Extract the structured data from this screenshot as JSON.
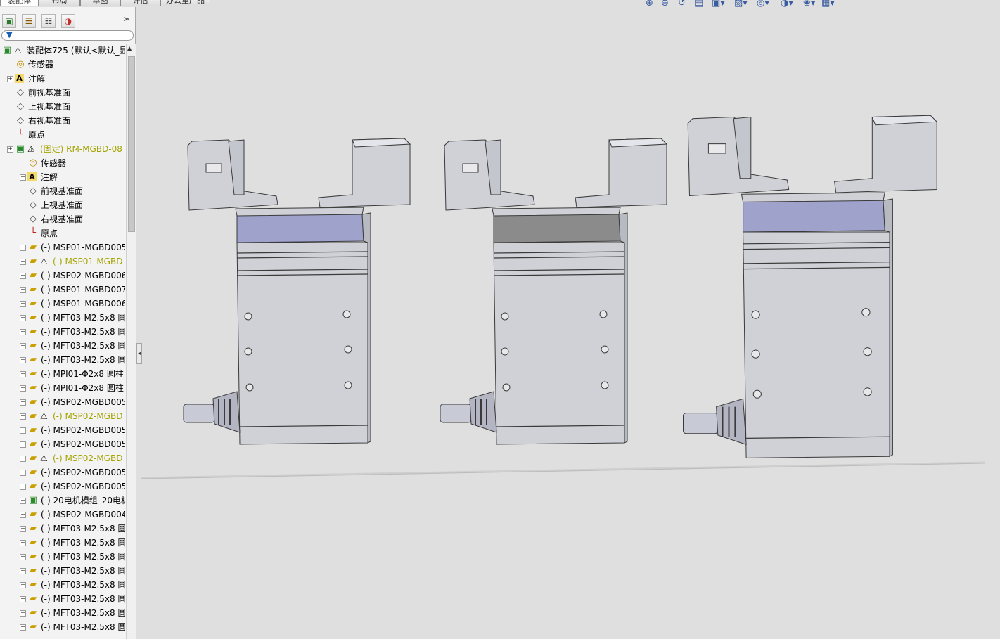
{
  "tabs": [
    "装配体",
    "布局",
    "草图",
    "评估",
    "办公室产品"
  ],
  "panel_icons": [
    {
      "name": "feature-manager-icon",
      "glyph": "▣"
    },
    {
      "name": "property-manager-icon",
      "glyph": "☰"
    },
    {
      "name": "configuration-manager-icon",
      "glyph": "☷"
    },
    {
      "name": "display-manager-icon",
      "glyph": "◑"
    }
  ],
  "tree": [
    {
      "label": "装配体725  (默认<默认_显",
      "depth": 0,
      "icon": "assembly",
      "warn": true,
      "exp": false,
      "style": "normal"
    },
    {
      "label": "传感器",
      "depth": 1,
      "icon": "sensor",
      "warn": false,
      "exp": false,
      "style": "normal"
    },
    {
      "label": "注解",
      "depth": 1,
      "icon": "annotation",
      "warn": false,
      "exp": true,
      "style": "normal"
    },
    {
      "label": "前视基准面",
      "depth": 1,
      "icon": "plane",
      "warn": false,
      "exp": false,
      "style": "normal"
    },
    {
      "label": "上视基准面",
      "depth": 1,
      "icon": "plane",
      "warn": false,
      "exp": false,
      "style": "normal"
    },
    {
      "label": "右视基准面",
      "depth": 1,
      "icon": "plane",
      "warn": false,
      "exp": false,
      "style": "normal"
    },
    {
      "label": "原点",
      "depth": 1,
      "icon": "origin",
      "warn": false,
      "exp": false,
      "style": "normal"
    },
    {
      "label": "(固定) RM-MGBD-08",
      "depth": 1,
      "icon": "subassembly",
      "warn": true,
      "exp": true,
      "style": "yellow"
    },
    {
      "label": "传感器",
      "depth": 2,
      "icon": "sensor",
      "warn": false,
      "exp": false,
      "style": "normal"
    },
    {
      "label": "注解",
      "depth": 2,
      "icon": "annotation",
      "warn": false,
      "exp": true,
      "style": "normal"
    },
    {
      "label": "前视基准面",
      "depth": 2,
      "icon": "plane",
      "warn": false,
      "exp": false,
      "style": "normal"
    },
    {
      "label": "上视基准面",
      "depth": 2,
      "icon": "plane",
      "warn": false,
      "exp": false,
      "style": "normal"
    },
    {
      "label": "右视基准面",
      "depth": 2,
      "icon": "plane",
      "warn": false,
      "exp": false,
      "style": "normal"
    },
    {
      "label": "原点",
      "depth": 2,
      "icon": "origin",
      "warn": false,
      "exp": false,
      "style": "normal"
    },
    {
      "label": "(-) MSP01-MGBD005",
      "depth": 2,
      "icon": "part",
      "warn": false,
      "exp": true,
      "style": "normal"
    },
    {
      "label": "(-) MSP01-MGBD",
      "depth": 2,
      "icon": "part",
      "warn": true,
      "exp": true,
      "style": "yellow"
    },
    {
      "label": "(-) MSP02-MGBD006",
      "depth": 2,
      "icon": "part",
      "warn": false,
      "exp": true,
      "style": "normal"
    },
    {
      "label": "(-) MSP01-MGBD007",
      "depth": 2,
      "icon": "part",
      "warn": false,
      "exp": true,
      "style": "normal"
    },
    {
      "label": "(-) MSP01-MGBD006",
      "depth": 2,
      "icon": "part",
      "warn": false,
      "exp": true,
      "style": "normal"
    },
    {
      "label": "(-) MFT03-M2.5x8 圆",
      "depth": 2,
      "icon": "part",
      "warn": false,
      "exp": true,
      "style": "normal"
    },
    {
      "label": "(-) MFT03-M2.5x8 圆",
      "depth": 2,
      "icon": "part",
      "warn": false,
      "exp": true,
      "style": "normal"
    },
    {
      "label": "(-) MFT03-M2.5x8 圆",
      "depth": 2,
      "icon": "part",
      "warn": false,
      "exp": true,
      "style": "normal"
    },
    {
      "label": "(-) MFT03-M2.5x8 圆",
      "depth": 2,
      "icon": "part",
      "warn": false,
      "exp": true,
      "style": "normal"
    },
    {
      "label": "(-) MPI01-Φ2x8 圆柱",
      "depth": 2,
      "icon": "part",
      "warn": false,
      "exp": true,
      "style": "normal"
    },
    {
      "label": "(-) MPI01-Φ2x8 圆柱",
      "depth": 2,
      "icon": "part",
      "warn": false,
      "exp": true,
      "style": "normal"
    },
    {
      "label": "(-) MSP02-MGBD005",
      "depth": 2,
      "icon": "part",
      "warn": false,
      "exp": true,
      "style": "normal"
    },
    {
      "label": "(-) MSP02-MGBD",
      "depth": 2,
      "icon": "part",
      "warn": true,
      "exp": true,
      "style": "yellow"
    },
    {
      "label": "(-) MSP02-MGBD005",
      "depth": 2,
      "icon": "part",
      "warn": false,
      "exp": true,
      "style": "normal"
    },
    {
      "label": "(-) MSP02-MGBD005",
      "depth": 2,
      "icon": "part",
      "warn": false,
      "exp": true,
      "style": "normal"
    },
    {
      "label": "(-) MSP02-MGBD",
      "depth": 2,
      "icon": "part",
      "warn": true,
      "exp": true,
      "style": "yellow"
    },
    {
      "label": "(-) MSP02-MGBD005",
      "depth": 2,
      "icon": "part",
      "warn": false,
      "exp": true,
      "style": "normal"
    },
    {
      "label": "(-) MSP02-MGBD005",
      "depth": 2,
      "icon": "part",
      "warn": false,
      "exp": true,
      "style": "normal"
    },
    {
      "label": "(-) 20电机模组_20电机",
      "depth": 2,
      "icon": "subassembly",
      "warn": false,
      "exp": true,
      "style": "normal"
    },
    {
      "label": "(-) MSP02-MGBD004",
      "depth": 2,
      "icon": "part",
      "warn": false,
      "exp": true,
      "style": "normal"
    },
    {
      "label": "(-) MFT03-M2.5x8 圆",
      "depth": 2,
      "icon": "part",
      "warn": false,
      "exp": true,
      "style": "normal"
    },
    {
      "label": "(-) MFT03-M2.5x8 圆",
      "depth": 2,
      "icon": "part",
      "warn": false,
      "exp": true,
      "style": "normal"
    },
    {
      "label": "(-) MFT03-M2.5x8 圆",
      "depth": 2,
      "icon": "part",
      "warn": false,
      "exp": true,
      "style": "normal"
    },
    {
      "label": "(-) MFT03-M2.5x8 圆",
      "depth": 2,
      "icon": "part",
      "warn": false,
      "exp": true,
      "style": "normal"
    },
    {
      "label": "(-) MFT03-M2.5x8 圆",
      "depth": 2,
      "icon": "part",
      "warn": false,
      "exp": true,
      "style": "normal"
    },
    {
      "label": "(-) MFT03-M2.5x8 圆",
      "depth": 2,
      "icon": "part",
      "warn": false,
      "exp": true,
      "style": "normal"
    },
    {
      "label": "(-) MFT03-M2.5x8 圆",
      "depth": 2,
      "icon": "part",
      "warn": false,
      "exp": true,
      "style": "normal"
    },
    {
      "label": "(-) MFT03-M2.5x8 圆",
      "depth": 2,
      "icon": "part",
      "warn": false,
      "exp": true,
      "style": "normal"
    }
  ],
  "hud_icons": [
    {
      "name": "zoom-to-fit-icon",
      "glyph": "⊕"
    },
    {
      "name": "zoom-to-area-icon",
      "glyph": "⊖"
    },
    {
      "name": "previous-view-icon",
      "glyph": "↺"
    },
    {
      "name": "section-view-icon",
      "glyph": "▤"
    },
    {
      "name": "view-orientation-icon",
      "glyph": "▣"
    },
    {
      "name": "display-style-icon",
      "glyph": "▧"
    },
    {
      "name": "hide-show-items-icon",
      "glyph": "◎"
    },
    {
      "name": "edit-appearance-icon",
      "glyph": "◑"
    },
    {
      "name": "apply-scene-icon",
      "glyph": "❀"
    },
    {
      "name": "view-settings-icon",
      "glyph": "▦"
    }
  ],
  "colors": {
    "background": "#dfdfdf",
    "part_body": "#cfd1d7",
    "part_edge": "#3a3a3a",
    "top_band_lavender": "#9fa3cc",
    "top_band_dark": "#8b8b8b",
    "warning_yellow": "#a4a400"
  },
  "models": [
    {
      "name": "gripper-1",
      "band": "lavender"
    },
    {
      "name": "gripper-2",
      "band": "dark"
    },
    {
      "name": "gripper-3",
      "band": "lavender"
    }
  ]
}
